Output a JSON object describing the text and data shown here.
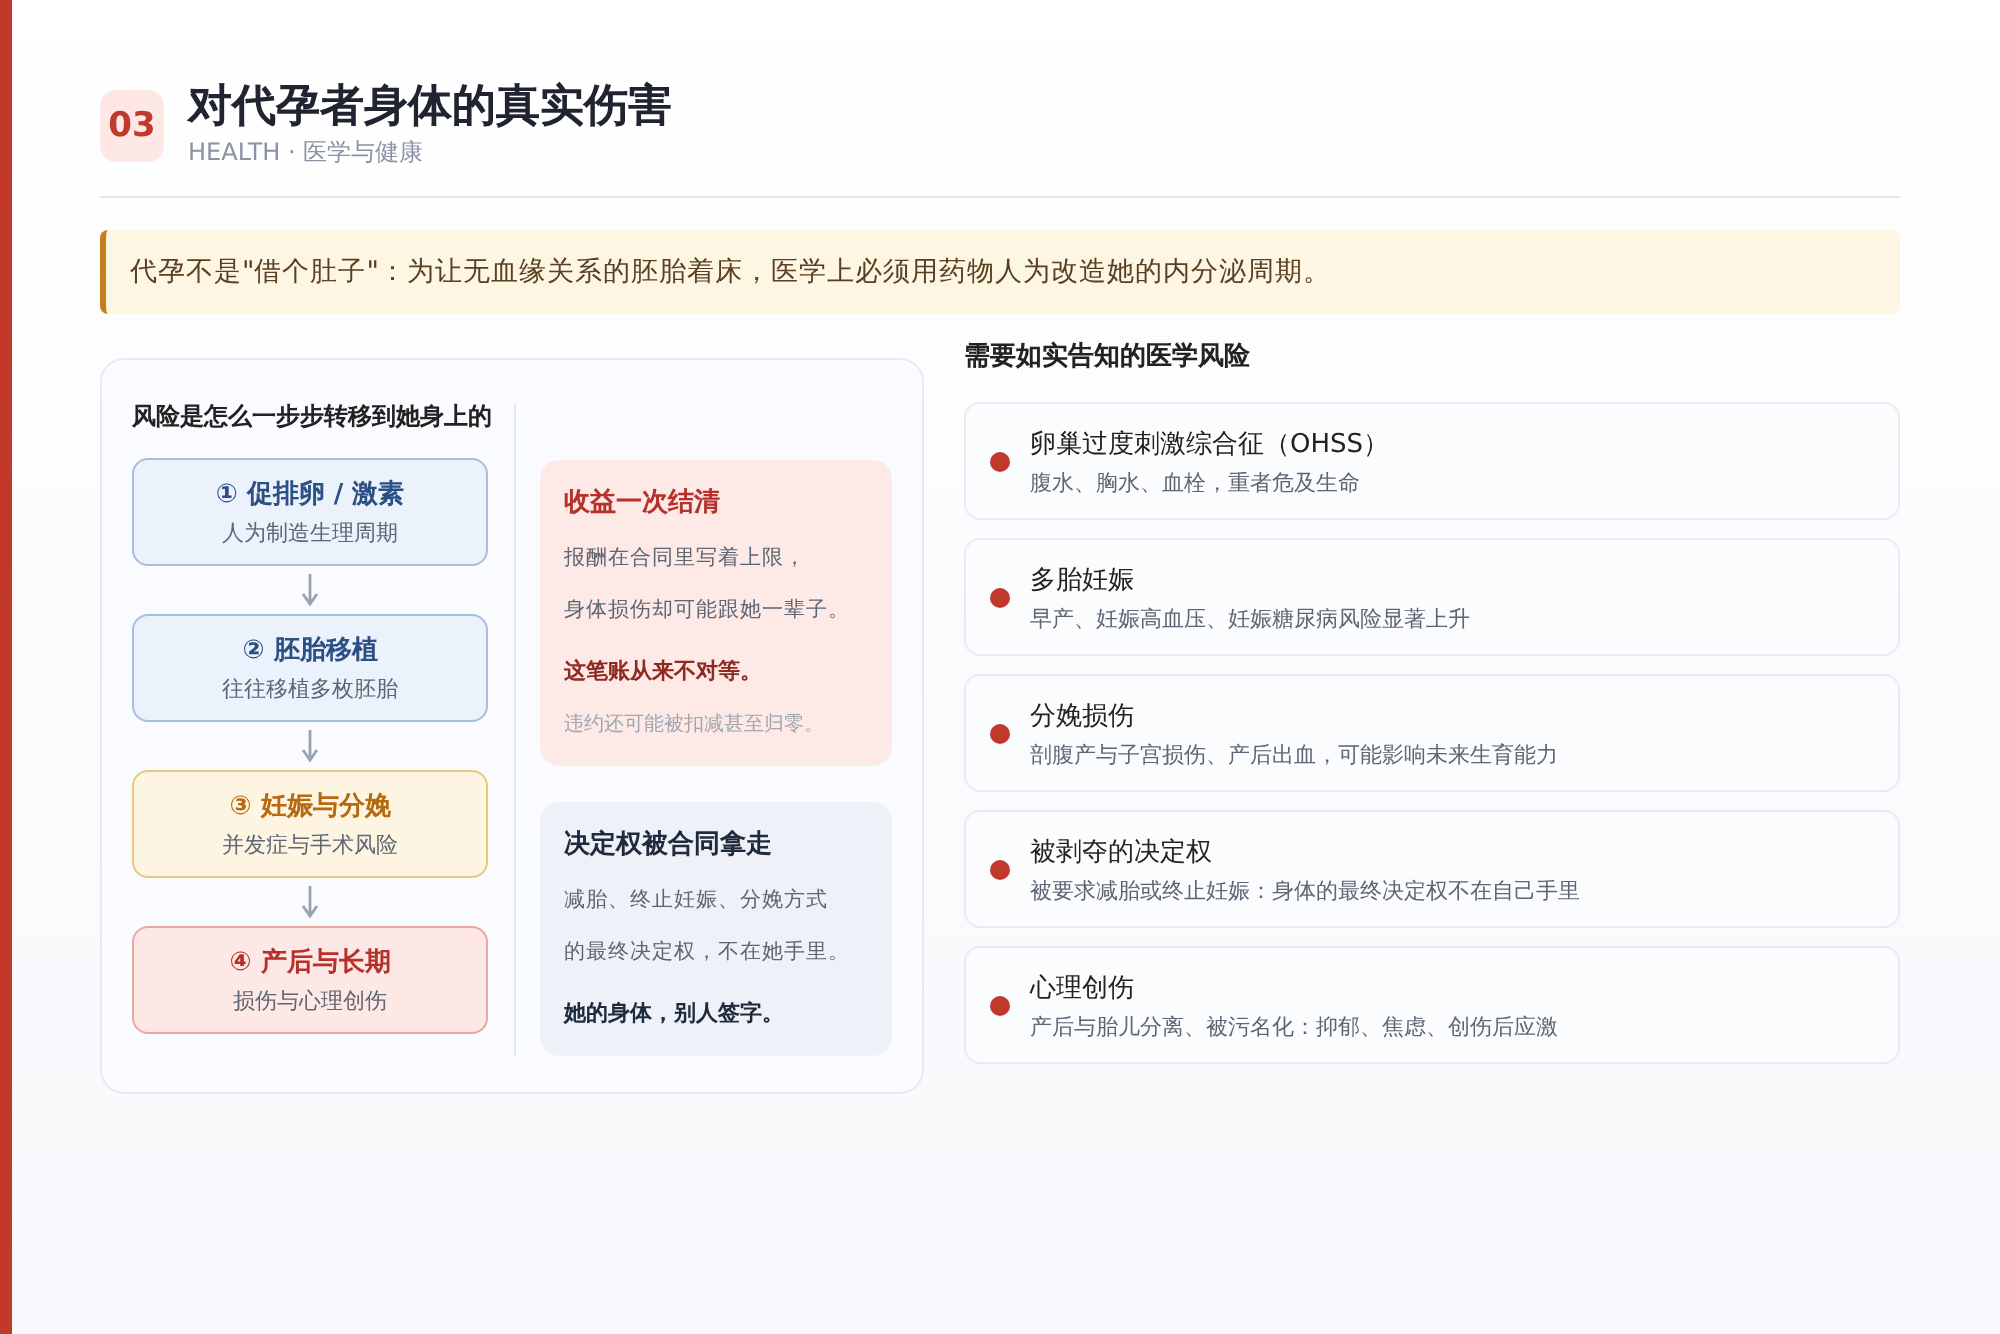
{
  "header": {
    "number": "03",
    "title": "对代孕者身体的真实伤害",
    "subtitle": "HEALTH · 医学与健康"
  },
  "notice": "代孕不是\"借个肚子\"：为让无血缘关系的胚胎着床，医学上必须用药物人为改造她的内分泌周期。",
  "flow": {
    "title": "风险是怎么一步步转移到她身上的",
    "steps": [
      {
        "kind": "blue",
        "title": "① 促排卵 / 激素",
        "text": "人为制造生理周期"
      },
      {
        "kind": "blue",
        "title": "② 胚胎移植",
        "text": "往往移植多枚胚胎"
      },
      {
        "kind": "amber",
        "title": "③ 妊娠与分娩",
        "text": "并发症与手术风险"
      },
      {
        "kind": "red",
        "title": "④ 产后与长期",
        "text": "损伤与心理创伤"
      }
    ],
    "callouts": [
      {
        "kind": "red",
        "title": "收益一次结清",
        "lines": [
          "报酬在合同里写着上限，",
          "身体损伤却可能跟她一辈子。"
        ],
        "emphasis": "这笔账从来不对等。",
        "note": "违约还可能被扣减甚至归零。"
      },
      {
        "kind": "slate",
        "title": "决定权被合同拿走",
        "lines": [
          "减胎、终止妊娠、分娩方式",
          "的最终决定权，不在她手里。"
        ],
        "emphasis": "她的身体，别人签字。"
      }
    ]
  },
  "risks": {
    "title": "需要如实告知的医学风险",
    "items": [
      {
        "color": "#c0392b",
        "title": "卵巢过度刺激综合征（OHSS）",
        "text": "腹水、胸水、血栓，重者危及生命"
      },
      {
        "color": "#c0392b",
        "title": "多胎妊娠",
        "text": "早产、妊娠高血压、妊娠糖尿病风险显著上升"
      },
      {
        "color": "#c0392b",
        "title": "分娩损伤",
        "text": "剖腹产与子宫损伤、产后出血，可能影响未来生育能力"
      },
      {
        "color": "#c0392b",
        "title": "被剥夺的决定权",
        "text": "被要求减胎或终止妊娠：身体的最终决定权不在自己手里"
      },
      {
        "color": "#c0392b",
        "title": "心理创伤",
        "text": "产后与胎儿分离、被污名化：抑郁、焦虑、创伤后应激"
      }
    ]
  }
}
